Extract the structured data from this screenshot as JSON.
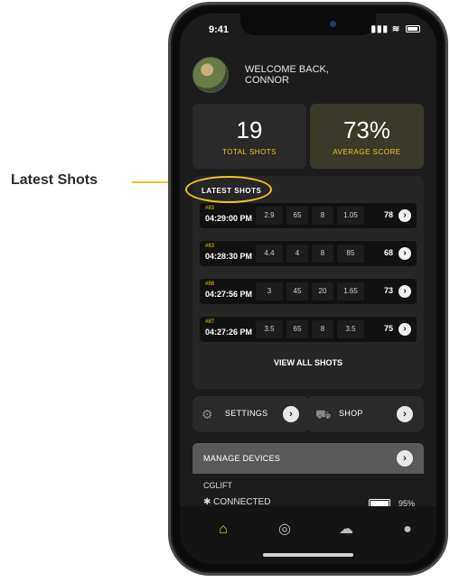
{
  "callout": {
    "label": "Latest Shots"
  },
  "status_bar": {
    "time": "9:41"
  },
  "welcome": {
    "line1": "WELCOME BACK,",
    "line2": "CONNOR"
  },
  "stats": {
    "total_shots": {
      "value": "19",
      "label": "TOTAL SHOTS"
    },
    "average_score": {
      "value": "73%",
      "label": "AVERAGE SCORE"
    }
  },
  "latest_shots": {
    "title": "LATEST SHOTS",
    "rows": [
      {
        "id": "#83",
        "time": "04:29:00 PM",
        "c1": "2.9",
        "c2": "65",
        "c3": "8",
        "c4": "1.05",
        "score": "78"
      },
      {
        "id": "#83",
        "time": "04:28:30 PM",
        "c1": "4.4",
        "c2": "4",
        "c3": "8",
        "c4": "85",
        "score": "68"
      },
      {
        "id": "#88",
        "time": "04:27:56 PM",
        "c1": "3",
        "c2": "45",
        "c3": "20",
        "c4": "1.65",
        "score": "73"
      },
      {
        "id": "#87",
        "time": "04:27:26 PM",
        "c1": "3.5",
        "c2": "65",
        "c3": "8",
        "c4": "3.5",
        "score": "75"
      }
    ],
    "view_all": "VIEW ALL SHOTS"
  },
  "buttons": {
    "settings": "SETTINGS",
    "shop": "SHOP"
  },
  "devices": {
    "header": "MANAGE DEVICES",
    "name": "CGLIFT",
    "status": "CONNECTED",
    "battery": "95%"
  },
  "colors": {
    "accent": "#f2c51c",
    "background": "#1c1c1c",
    "card": "#2a2a2a"
  }
}
